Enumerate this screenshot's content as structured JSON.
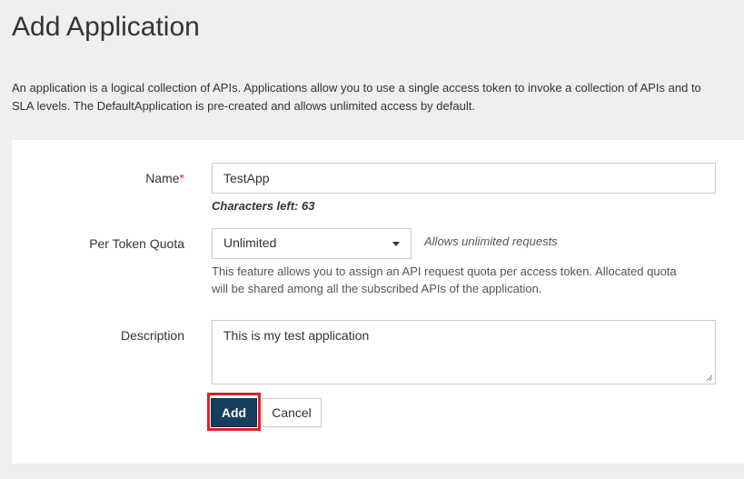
{
  "page": {
    "title": "Add Application",
    "intro_line1": "An application is a logical collection of APIs. Applications allow you to use a single access token to invoke a collection of APIs and to",
    "intro_line2": "SLA levels. The DefaultApplication is pre-created and allows unlimited access by default."
  },
  "form": {
    "name": {
      "label": "Name",
      "required_marker": "*",
      "value": "TestApp",
      "chars_left": "Characters left: 63"
    },
    "quota": {
      "label": "Per Token Quota",
      "selected": "Unlimited",
      "selected_hint": "Allows unlimited requests",
      "help_line1": "This feature allows you to assign an API request quota per access token. Allocated quota",
      "help_line2": "will be shared among all the subscribed APIs of the application."
    },
    "description": {
      "label": "Description",
      "value": "This is my test application"
    }
  },
  "actions": {
    "add_label": "Add",
    "cancel_label": "Cancel"
  },
  "icons": {
    "select_caret": "chevron-down-icon",
    "resize": "resize-handle-icon"
  },
  "colors": {
    "background": "#efefef",
    "panel": "#ffffff",
    "primary_button": "#163f5e",
    "required": "#d9232d",
    "highlight": "#d9232d"
  }
}
